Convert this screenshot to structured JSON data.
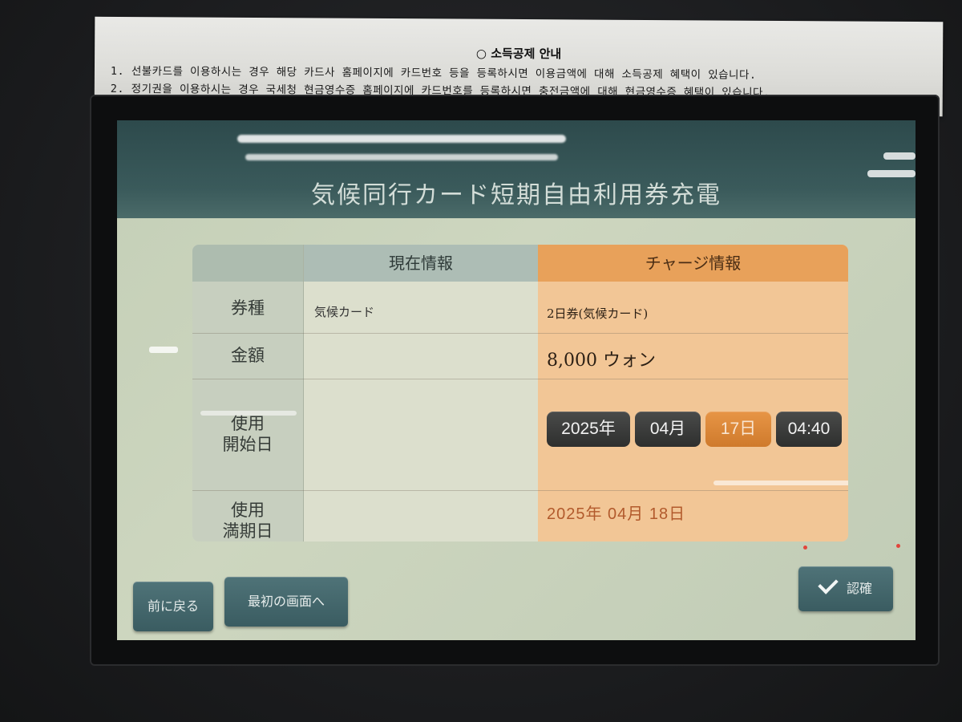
{
  "notice": {
    "title": "○ 소득공제 안내",
    "line1": "1. 선불카드를 이용하시는 경우 해당 카드사 홈페이지에 카드번호 등을 등록하시면 이용금액에 대해 소득공제 혜택이 있습니다.",
    "line2": "2. 정기권을 이용하시는 경우 국세청 현금영수증 홈페이지에 카드번호를 등록하시면 충전금액에 대해 현금영수증 혜택이 있습니다."
  },
  "screen": {
    "title": "気候同行カード短期自由利用券充電"
  },
  "table": {
    "headers": {
      "current": "現在情報",
      "charge": "チャージ情報"
    },
    "rows": {
      "type": {
        "label": "券種",
        "current": "気候カード",
        "charge": "2日券(気候カード)"
      },
      "amount": {
        "label": "金額",
        "current": "",
        "charge": "8,000 ウォン"
      },
      "start": {
        "label_line1": "使用",
        "label_line2": "開始日",
        "year": "2025年",
        "month": "04月",
        "day": "17日",
        "time": "04:40"
      },
      "expiry": {
        "label_line1": "使用",
        "label_line2": "満期日",
        "value": "2025年 04月 18日"
      }
    }
  },
  "buttons": {
    "back": "前に戻る",
    "home": "最初の画面へ",
    "confirm": "認確"
  },
  "colors": {
    "header_bg": "#2d4a4c",
    "charge_col": "#f2c696",
    "charge_header": "#e8a15a",
    "active_pill": "#e08a3b",
    "button_bg": "#466a6f",
    "expiry_text": "#b25a2c"
  },
  "icons": {
    "confirm": "check-icon"
  }
}
